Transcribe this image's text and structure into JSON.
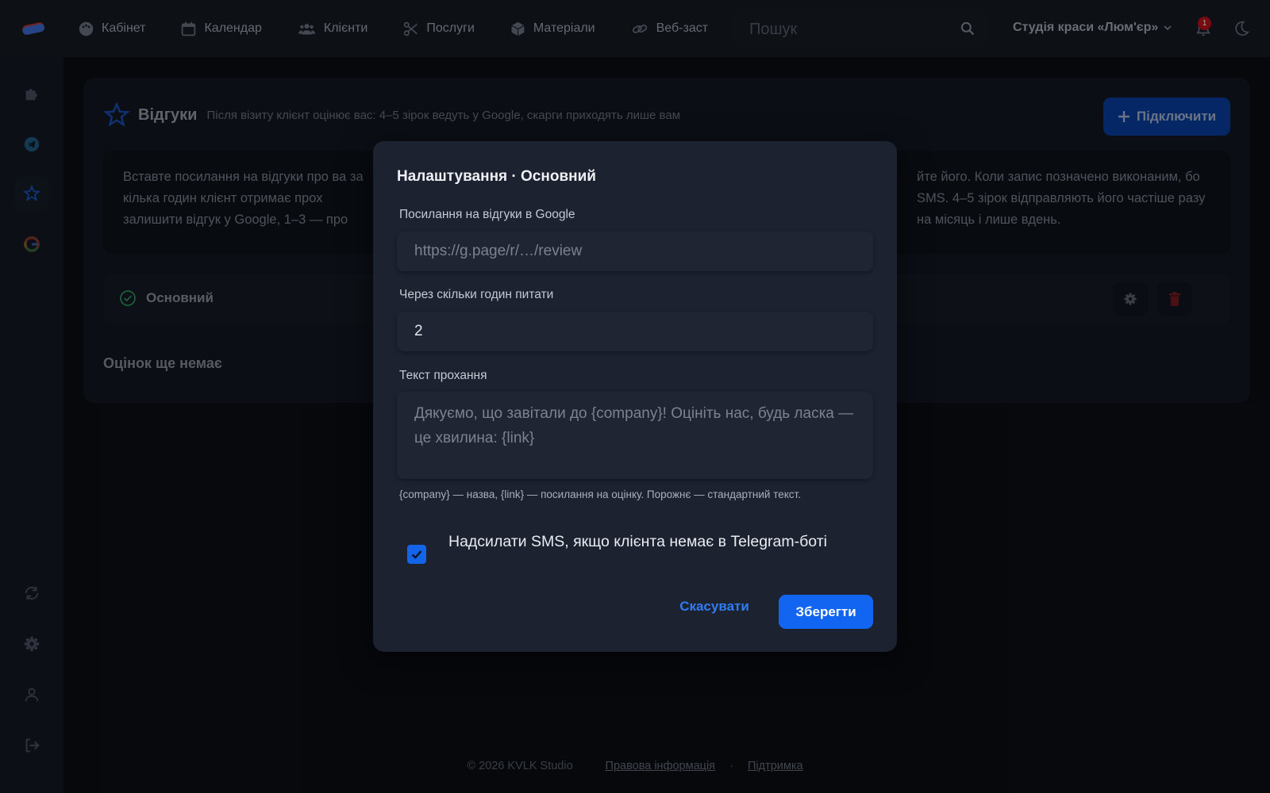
{
  "topbar": {
    "nav": [
      {
        "label": "Кабінет",
        "icon": "palette-icon"
      },
      {
        "label": "Календар",
        "icon": "calendar-icon"
      },
      {
        "label": "Клієнти",
        "icon": "users-icon"
      },
      {
        "label": "Послуги",
        "icon": "scissors-icon"
      },
      {
        "label": "Матеріали",
        "icon": "box-icon"
      },
      {
        "label": "Веб-заст",
        "icon": "link-icon"
      }
    ],
    "search_placeholder": "Пошук",
    "studio_name": "Студія краси «Люм'єр»",
    "notifications_count": "1"
  },
  "sidebar": {
    "items": [
      "puzzle-icon",
      "telegram-icon",
      "star-icon",
      "google-icon",
      "sync-icon",
      "gear-icon",
      "user-icon",
      "logout-icon"
    ],
    "active": "star-icon"
  },
  "card": {
    "title": "Відгуки",
    "subtitle": "Після візиту клієнт оцінює вас: 4–5 зірок ведуть у Google, скарги приходять лише вам",
    "connect_label": "Підключити",
    "info_left": "Вставте посилання на відгуки про ва за кілька годин клієнт отримає прох залишити відгук у Google, 1–3 — про",
    "info_right": "йте його. Коли запис позначено виконаним, бо SMS. 4–5 зірок відправляють його частіше разу на місяць і лише вдень.",
    "row_label": "Основний",
    "empty_text": "Оцінок ще немає"
  },
  "modal": {
    "title": "Налаштування · Основний",
    "google_link_label": "Посилання на відгуки в Google",
    "google_link_placeholder": "https://g.page/r/…/review",
    "hours_label": "Через скільки годин питати",
    "hours_value": "2",
    "request_text_label": "Текст прохання",
    "request_text_placeholder": "Дякуємо, що завітали до {company}! Оцініть нас, будь ласка — це хвилина: {link}",
    "hint": "{company} — назва, {link} — посилання на оцінку. Порожнє — стандартний текст.",
    "sms_checkbox_label": "Надсилати SMS, якщо клієнта немає в Telegram-боті",
    "sms_checked": true,
    "cancel_label": "Скасувати",
    "save_label": "Зберегти"
  },
  "footer": {
    "copyright": "© 2026 KVLK Studio",
    "legal_link": "Правова інформація",
    "separator": "·",
    "support_link": "Підтримка"
  },
  "colors": {
    "accent": "#1165f0",
    "danger": "#c0121a",
    "success": "#2a9a5a"
  }
}
